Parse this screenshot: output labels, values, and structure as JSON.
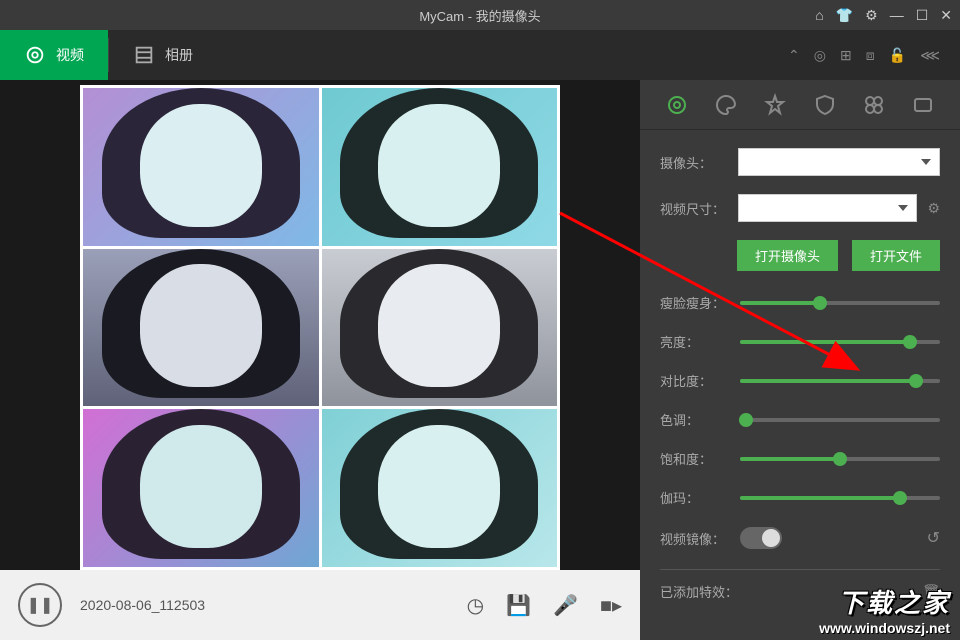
{
  "titlebar": {
    "title": "MyCam - 我的摄像头"
  },
  "tabs": {
    "video": "视频",
    "album": "相册"
  },
  "bottom": {
    "filename": "2020-08-06_112503"
  },
  "side": {
    "camera_label": "摄像头：",
    "video_size_label": "视频尺寸：",
    "open_camera": "打开摄像头",
    "open_file": "打开文件",
    "sliders": {
      "slim": {
        "label": "瘦脸瘦身：",
        "pct": 40
      },
      "brightness": {
        "label": "亮度：",
        "pct": 85
      },
      "contrast": {
        "label": "对比度：",
        "pct": 88
      },
      "hue": {
        "label": "色调：",
        "pct": 3
      },
      "saturation": {
        "label": "饱和度：",
        "pct": 50
      },
      "gamma": {
        "label": "伽玛：",
        "pct": 80
      }
    },
    "mirror_label": "视频镜像：",
    "effects_label": "已添加特效："
  },
  "watermark": {
    "top": "下载之家",
    "bot": "www.windowszj.net"
  }
}
